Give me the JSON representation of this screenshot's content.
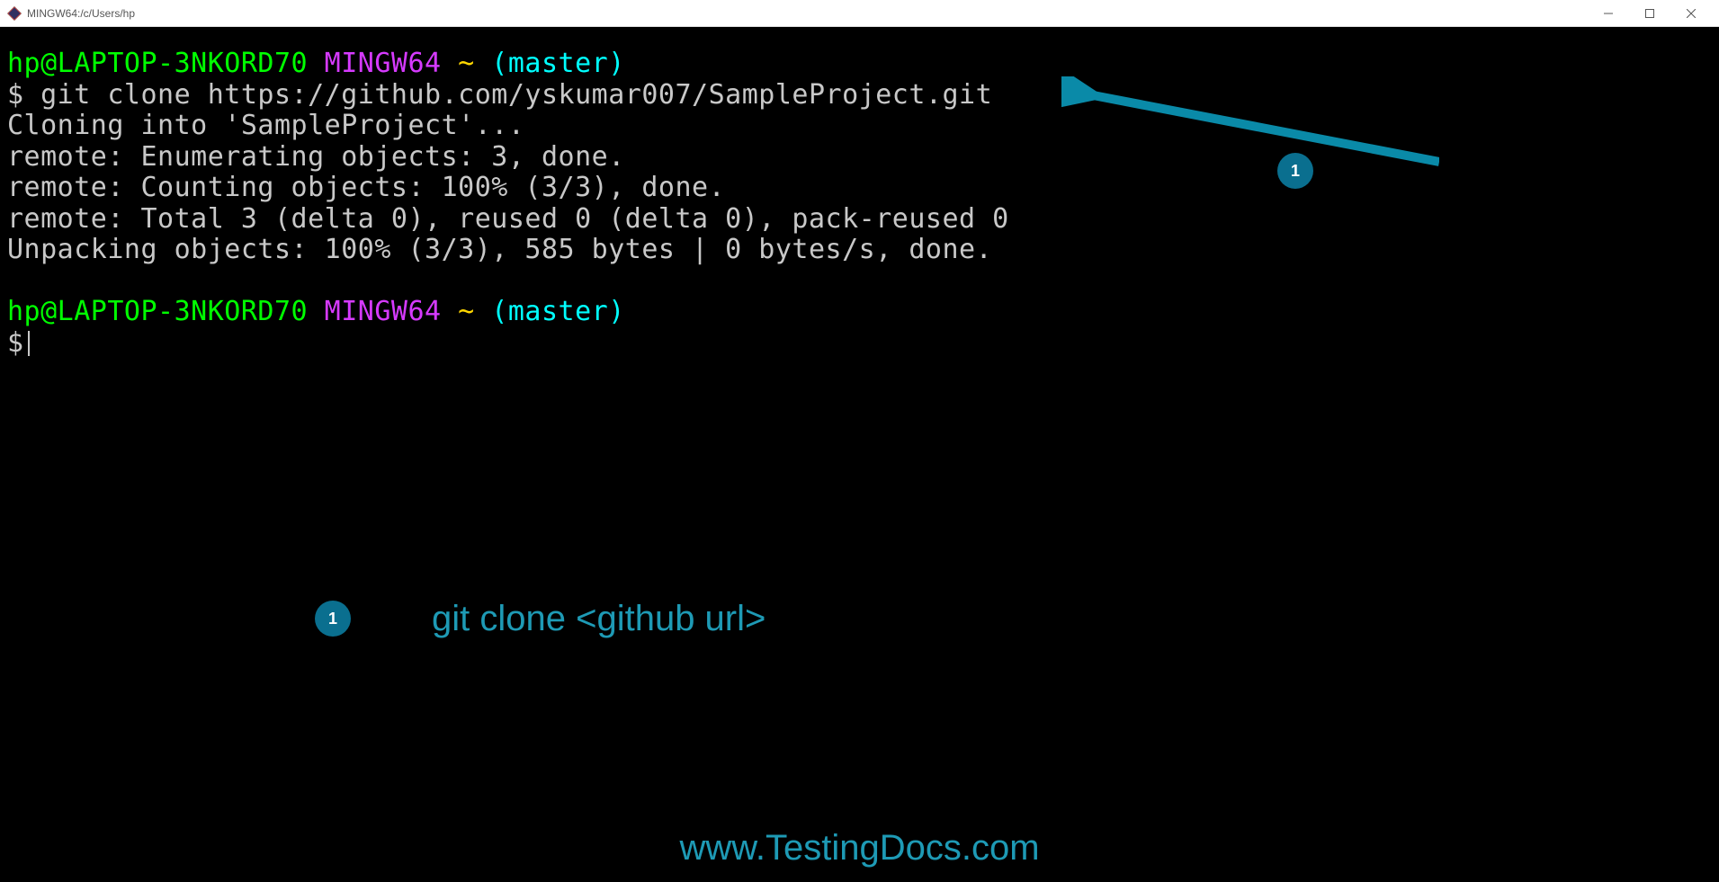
{
  "window": {
    "title": "MINGW64:/c/Users/hp"
  },
  "prompt1": {
    "userHost": "hp@LAPTOP-3NKORD70",
    "mingw": "MINGW64",
    "path": "~",
    "branch": "(master)"
  },
  "command1": {
    "dollar": "$ ",
    "text": "git clone https://github.com/yskumar007/SampleProject.git"
  },
  "output": {
    "l1": "Cloning into 'SampleProject'...",
    "l2": "remote: Enumerating objects: 3, done.",
    "l3": "remote: Counting objects: 100% (3/3), done.",
    "l4": "remote: Total 3 (delta 0), reused 0 (delta 0), pack-reused 0",
    "l5": "Unpacking objects: 100% (3/3), 585 bytes | 0 bytes/s, done."
  },
  "prompt2": {
    "userHost": "hp@LAPTOP-3NKORD70",
    "mingw": "MINGW64",
    "path": "~",
    "branch": "(master)"
  },
  "command2": {
    "dollar": "$"
  },
  "annotation": {
    "badge1": "1",
    "badge2": "1",
    "legend": "git clone  <github url>"
  },
  "footer": {
    "url": "www.TestingDocs.com"
  }
}
